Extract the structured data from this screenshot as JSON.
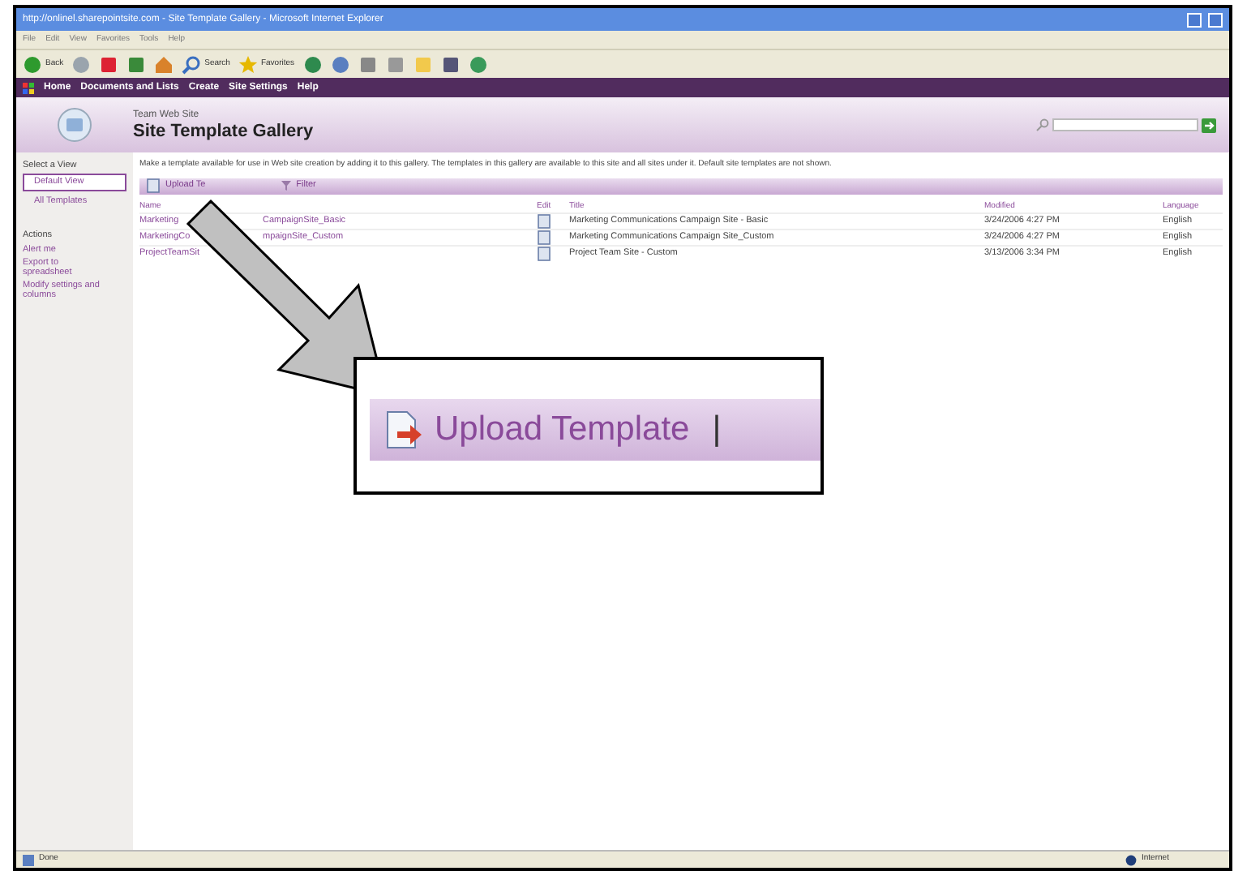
{
  "window": {
    "title": "http://onlinel.sharepointsite.com - Site Template Gallery - Microsoft Internet Explorer"
  },
  "menu": [
    "File",
    "Edit",
    "View",
    "Favorites",
    "Tools",
    "Help"
  ],
  "toolbar": [
    {
      "kind": "back",
      "label": "Back"
    },
    {
      "kind": "forward"
    },
    {
      "kind": "stop"
    },
    {
      "kind": "refresh"
    },
    {
      "kind": "home"
    },
    {
      "kind": "search",
      "label": "Search"
    },
    {
      "kind": "favorites",
      "label": "Favorites"
    },
    {
      "kind": "history"
    },
    {
      "kind": "mail"
    },
    {
      "kind": "print"
    },
    {
      "kind": "edit"
    },
    {
      "kind": "folder"
    },
    {
      "kind": "research"
    },
    {
      "kind": "messenger"
    }
  ],
  "nav": [
    "Home",
    "Documents and Lists",
    "Create",
    "Site Settings",
    "Help"
  ],
  "header": {
    "site": "Team Web Site",
    "title": "Site Template Gallery"
  },
  "sidebar": {
    "view_heading": "Select a View",
    "views": [
      {
        "label": "Default View",
        "selected": true
      },
      {
        "label": "All Templates",
        "selected": false
      }
    ],
    "actions_heading": "Actions",
    "actions": [
      "Alert me",
      "Export to spreadsheet",
      "Modify settings and columns"
    ]
  },
  "description": "Make a template available for use in Web site creation by adding it to this gallery. The templates in this gallery are available to this site and all sites under it. Default site templates are not shown.",
  "list_toolbar": {
    "upload": "Upload Te",
    "filter": "Filter"
  },
  "table": {
    "columns": [
      "Name",
      "Edit",
      "Title",
      "Modified",
      "Language"
    ],
    "rows": [
      {
        "name_start": "Marketing",
        "name_end": "CampaignSite_Basic",
        "title": "Marketing Communications Campaign Site - Basic",
        "modified": "3/24/2006 4:27 PM",
        "language": "English"
      },
      {
        "name_start": "MarketingCo",
        "name_end": "mpaignSite_Custom",
        "title": "Marketing Communications Campaign Site_Custom",
        "modified": "3/24/2006 4:27 PM",
        "language": "English"
      },
      {
        "name_start": "ProjectTeamSit",
        "name_end": "",
        "title": "Project Team Site - Custom",
        "modified": "3/13/2006 3:34 PM",
        "language": "English"
      }
    ]
  },
  "callout": {
    "label": "Upload Template",
    "separator": "|"
  },
  "status_bar": {
    "left": "Done",
    "right": "Internet"
  }
}
